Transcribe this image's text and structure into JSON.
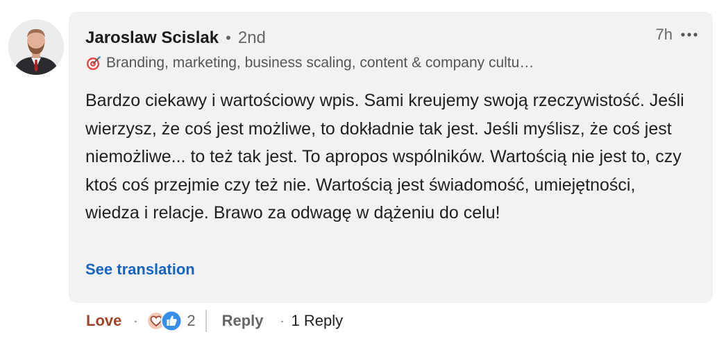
{
  "comment": {
    "author_name": "Jaroslaw Scislak",
    "separator": "•",
    "connection_degree": "2nd",
    "timestamp": "7h",
    "headline": "Branding, marketing, business scaling, content & company cultu…",
    "headline_icon": "target-emoji-icon",
    "text": "Bardzo ciekawy i wartościowy wpis. Sami kreujemy swoją rzeczywistość. Jeśli wierzysz, że coś jest możliwe, to dokładnie tak jest. Jeśli myślisz, że coś jest niemożliwe... to też tak jest. To apropos wspólników. Wartością nie jest to, czy ktoś coś przejmie czy też nie. Wartością jest świadomość, umiejętności, wiedza i relacje. Brawo za odwagę w dążeniu do celu!",
    "see_translation": "See translation"
  },
  "actions": {
    "reaction_label": "Love",
    "dot": "·",
    "reaction_count": "2",
    "reaction_icons": [
      "love-reaction-icon",
      "like-reaction-icon"
    ],
    "reply_label": "Reply",
    "replies_label": "1 Reply"
  },
  "colors": {
    "bubble_bg": "#f2f2f2",
    "link_blue": "#1565c0",
    "love_red": "#a1432a",
    "like_blue": "#378fe9",
    "muted_text": "#666666"
  }
}
